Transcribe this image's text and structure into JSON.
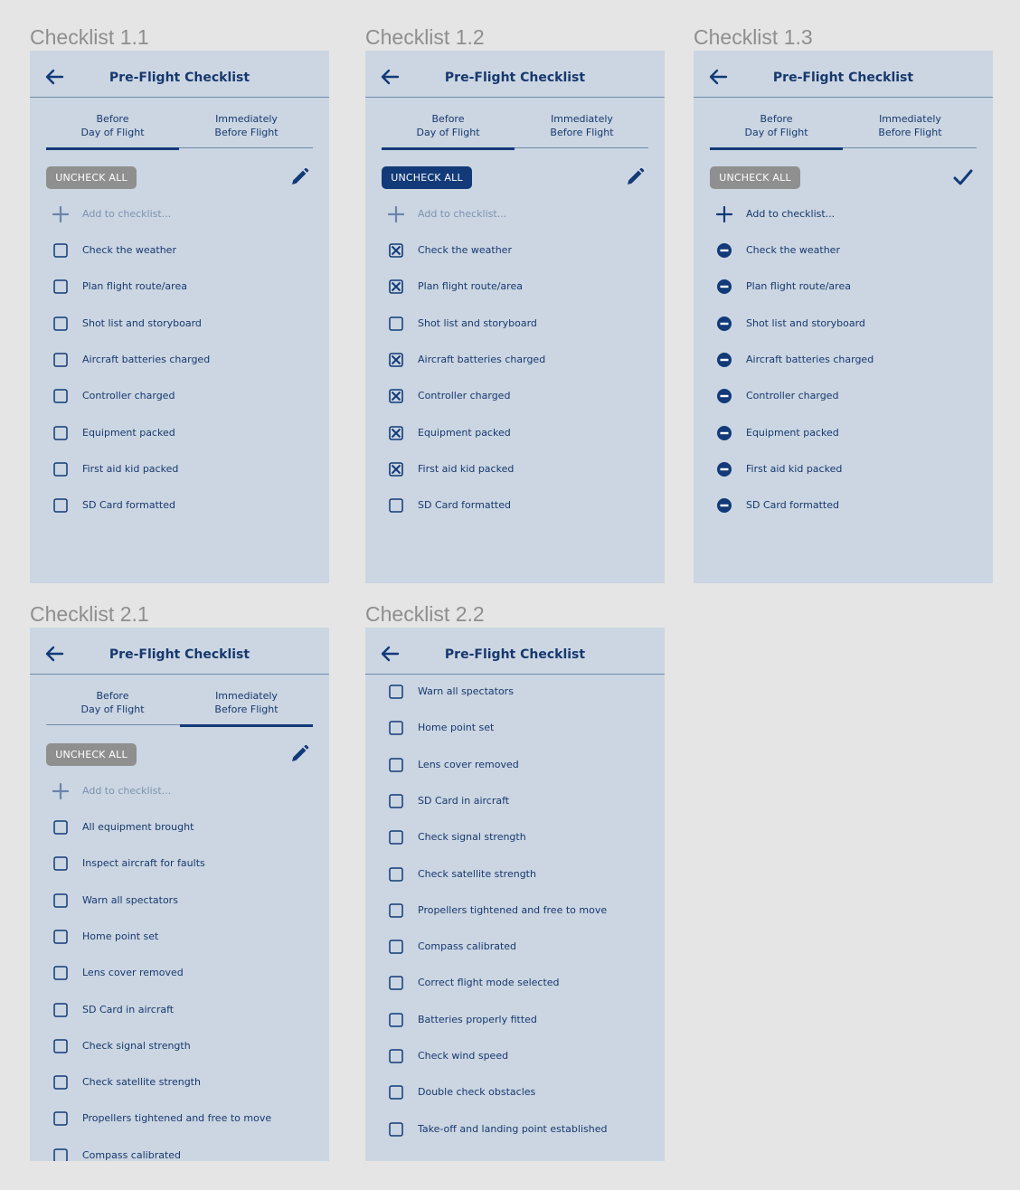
{
  "common": {
    "title": "Pre-Flight Checklist",
    "tab_before": "Before\nDay of Flight",
    "tab_immediate": "Immediately\nBefore Flight",
    "uncheck_all": "UNCHECK ALL",
    "add_placeholder": "Add to checklist..."
  },
  "colors": {
    "accent": "#123a78",
    "panel": "#cbd6e2",
    "disabled_button": "#8f8f8f",
    "page_bg": "#e5e5e5"
  },
  "frames": [
    {
      "label": "Checklist 1.1",
      "active_tab": "before",
      "uncheck_style": "disabled",
      "tool_icon": "pencil-icon",
      "mode": "check",
      "show_tabs": true,
      "items": [
        {
          "label": "Check the weather",
          "checked": false
        },
        {
          "label": "Plan flight route/area",
          "checked": false
        },
        {
          "label": "Shot list and storyboard",
          "checked": false
        },
        {
          "label": "Aircraft batteries charged",
          "checked": false
        },
        {
          "label": "Controller charged",
          "checked": false
        },
        {
          "label": "Equipment packed",
          "checked": false
        },
        {
          "label": "First aid kid packed",
          "checked": false
        },
        {
          "label": "SD Card formatted",
          "checked": false
        }
      ]
    },
    {
      "label": "Checklist 1.2",
      "active_tab": "before",
      "uncheck_style": "active",
      "tool_icon": "pencil-icon",
      "mode": "check",
      "show_tabs": true,
      "items": [
        {
          "label": "Check the weather",
          "checked": true
        },
        {
          "label": "Plan flight route/area",
          "checked": true
        },
        {
          "label": "Shot list and storyboard",
          "checked": false
        },
        {
          "label": "Aircraft batteries charged",
          "checked": true
        },
        {
          "label": "Controller charged",
          "checked": true
        },
        {
          "label": "Equipment packed",
          "checked": true
        },
        {
          "label": "First aid kid packed",
          "checked": true
        },
        {
          "label": "SD Card formatted",
          "checked": false
        }
      ]
    },
    {
      "label": "Checklist 1.3",
      "active_tab": "before",
      "uncheck_style": "disabled",
      "tool_icon": "checkmark-icon",
      "mode": "edit",
      "show_tabs": true,
      "items": [
        {
          "label": "Check the weather",
          "checked": false
        },
        {
          "label": "Plan flight route/area",
          "checked": false
        },
        {
          "label": "Shot list and storyboard",
          "checked": false
        },
        {
          "label": "Aircraft batteries charged",
          "checked": false
        },
        {
          "label": "Controller charged",
          "checked": false
        },
        {
          "label": "Equipment packed",
          "checked": false
        },
        {
          "label": "First aid kid packed",
          "checked": false
        },
        {
          "label": "SD Card formatted",
          "checked": false
        }
      ]
    },
    {
      "label": "Checklist 2.1",
      "active_tab": "immediate",
      "uncheck_style": "disabled",
      "tool_icon": "pencil-icon",
      "mode": "check",
      "show_tabs": true,
      "items": [
        {
          "label": "All equipment brought",
          "checked": false
        },
        {
          "label": "Inspect aircraft for faults",
          "checked": false
        },
        {
          "label": "Warn all spectators",
          "checked": false
        },
        {
          "label": "Home point set",
          "checked": false
        },
        {
          "label": "Lens cover removed",
          "checked": false
        },
        {
          "label": "SD Card in aircraft",
          "checked": false
        },
        {
          "label": "Check signal strength",
          "checked": false
        },
        {
          "label": "Check satellite strength",
          "checked": false
        },
        {
          "label": "Propellers tightened and free to move",
          "checked": false
        },
        {
          "label": "Compass calibrated",
          "checked": false
        }
      ]
    },
    {
      "label": "Checklist 2.2",
      "active_tab": "immediate",
      "uncheck_style": "none",
      "tool_icon": "",
      "mode": "check",
      "show_tabs": false,
      "items": [
        {
          "label": "Warn all spectators",
          "checked": false
        },
        {
          "label": "Home point set",
          "checked": false
        },
        {
          "label": "Lens cover removed",
          "checked": false
        },
        {
          "label": "SD Card in aircraft",
          "checked": false
        },
        {
          "label": "Check signal strength",
          "checked": false
        },
        {
          "label": "Check satellite strength",
          "checked": false
        },
        {
          "label": "Propellers tightened and free to move",
          "checked": false
        },
        {
          "label": "Compass calibrated",
          "checked": false
        },
        {
          "label": "Correct flight mode selected",
          "checked": false
        },
        {
          "label": "Batteries properly fitted",
          "checked": false
        },
        {
          "label": "Check wind speed",
          "checked": false
        },
        {
          "label": "Double check obstacles",
          "checked": false
        },
        {
          "label": "Take-off and landing point established",
          "checked": false
        }
      ]
    }
  ]
}
